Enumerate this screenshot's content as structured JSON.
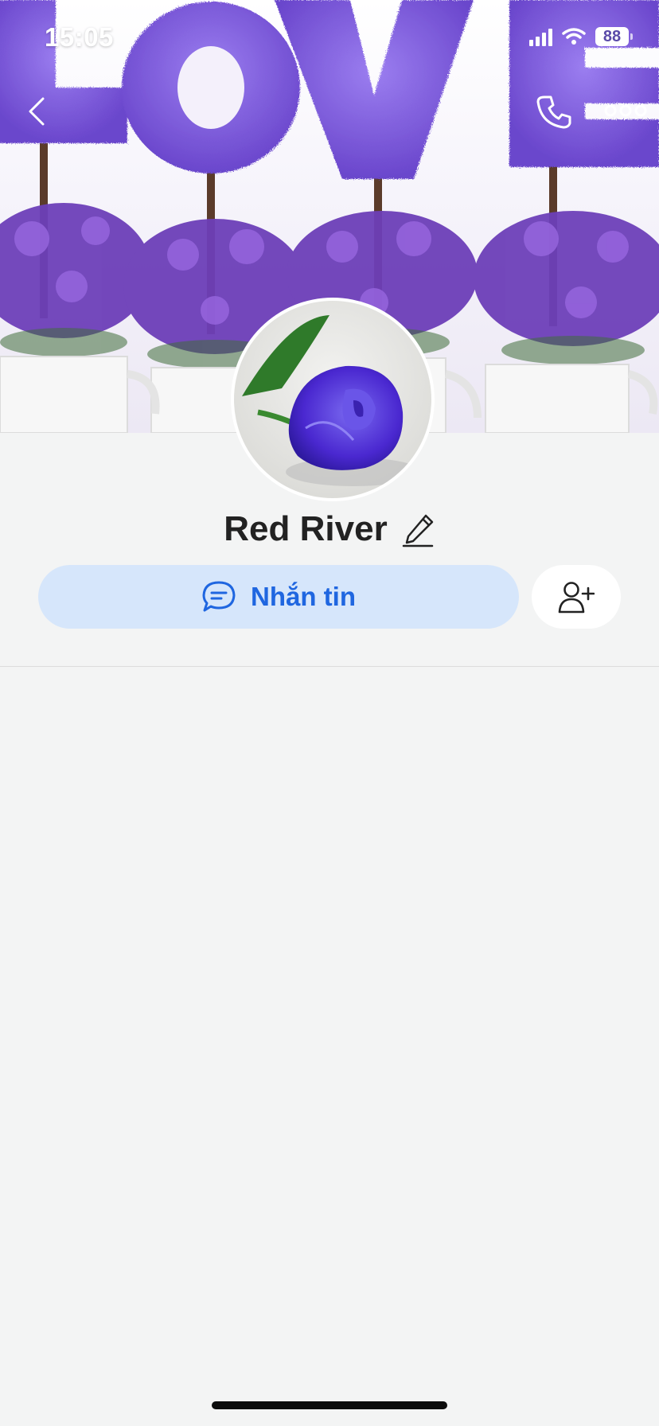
{
  "status_bar": {
    "time": "15:05",
    "battery": "88"
  },
  "cover": {
    "lettering": "LOVE",
    "accent_color": "#7a55d8"
  },
  "header": {
    "back_icon": "chevron-left-icon",
    "call_icon": "phone-icon",
    "more_icon": "more-dots-icon"
  },
  "profile": {
    "name": "Red River",
    "edit_icon": "pencil-icon",
    "avatar_subject": "purple-rose"
  },
  "actions": {
    "message_label": "Nhắn tin",
    "message_icon": "chat-bubble-icon",
    "add_friend_icon": "add-user-icon",
    "message_bg": "#d6e6fb",
    "message_color": "#1f66e0"
  }
}
